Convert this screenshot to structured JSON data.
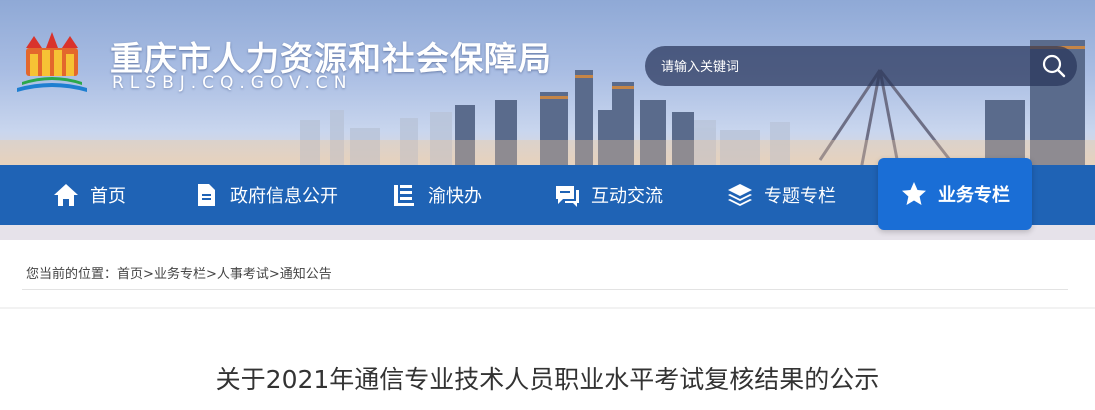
{
  "header": {
    "site_title": "重庆市人力资源和社会保障局",
    "site_domain": "RLSBJ.CQ.GOV.CN",
    "search_placeholder": "请输入关键词"
  },
  "nav": {
    "items": [
      {
        "label": "首页",
        "icon": "home-icon"
      },
      {
        "label": "政府信息公开",
        "icon": "document-icon"
      },
      {
        "label": "渝快办",
        "icon": "form-icon"
      },
      {
        "label": "互动交流",
        "icon": "chat-icon"
      },
      {
        "label": "专题专栏",
        "icon": "layers-icon"
      },
      {
        "label": "业务专栏",
        "icon": "star-icon",
        "active": true
      }
    ]
  },
  "breadcrumb": {
    "prefix": "您当前的位置：",
    "items": [
      "首页",
      "业务专栏",
      "人事考试",
      "通知公告"
    ],
    "separator": ">"
  },
  "article": {
    "title": "关于2021年通信专业技术人员职业水平考试复核结果的公示"
  },
  "colors": {
    "nav_bg": "#1f63b5",
    "nav_active_bg": "#1a6ed6",
    "search_bg": "#2a3658"
  }
}
